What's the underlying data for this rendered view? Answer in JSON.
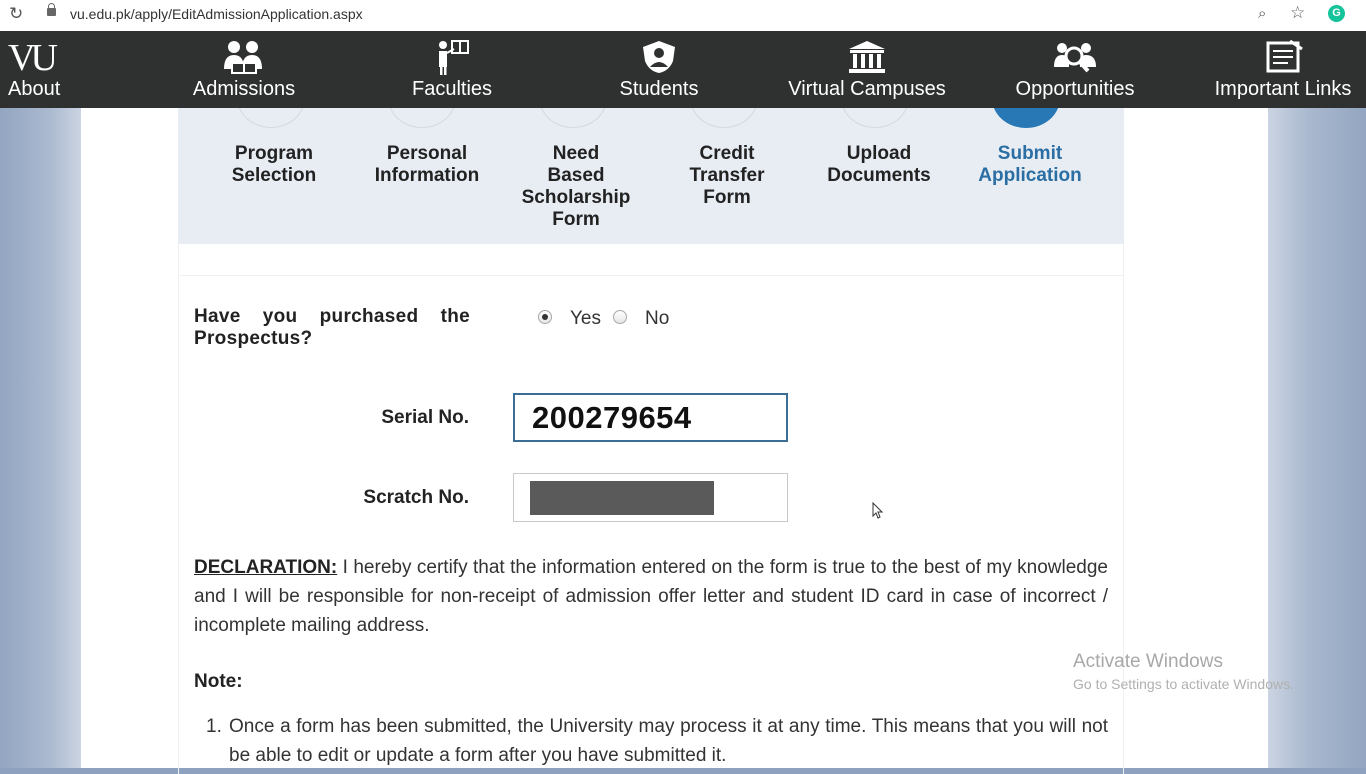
{
  "browser": {
    "url": "vu.edu.pk/apply/EditAdmissionApplication.aspx",
    "icons": [
      "reload-icon",
      "lock-icon",
      "zoom-icon",
      "bookmark-star-icon",
      "grammarly-icon"
    ],
    "ext_letter": "G"
  },
  "nav": {
    "logo": "VU",
    "items": [
      {
        "label": "About",
        "icon": "vu-logo"
      },
      {
        "label": "Admissions",
        "icon": "people-book-icon"
      },
      {
        "label": "Faculties",
        "icon": "teacher-board-icon"
      },
      {
        "label": "Students",
        "icon": "student-shield-icon"
      },
      {
        "label": "Virtual Campuses",
        "icon": "building-columns-icon"
      },
      {
        "label": "Opportunities",
        "icon": "people-search-icon"
      },
      {
        "label": "Important Links",
        "icon": "document-icon"
      }
    ]
  },
  "steps": [
    {
      "line1": "Program",
      "line2": "Selection",
      "line3": "",
      "line4": ""
    },
    {
      "line1": "Personal",
      "line2": "Information",
      "line3": "",
      "line4": ""
    },
    {
      "line1": "Need",
      "line2": "Based",
      "line3": "Scholarship",
      "line4": "Form"
    },
    {
      "line1": "Credit",
      "line2": "Transfer",
      "line3": "Form",
      "line4": ""
    },
    {
      "line1": "Upload",
      "line2": "Documents",
      "line3": "",
      "line4": ""
    },
    {
      "line1": "Submit",
      "line2": "Application",
      "line3": "",
      "line4": ""
    }
  ],
  "form": {
    "prospectus_q_line1": "Have you purchased the",
    "prospectus_q_line2": "Prospectus?",
    "yes_label": "Yes",
    "no_label": "No",
    "selected": "Yes",
    "serial_label": "Serial No.",
    "serial_value": "200279654",
    "scratch_label": "Scratch No."
  },
  "declaration": {
    "title": "DECLARATION:",
    "text": " I hereby certify that the information entered on the form is true to the best of my knowledge and I will be responsible for non-receipt of admission offer letter and student ID card in case of incorrect / incomplete mailing address."
  },
  "note": {
    "title": "Note:",
    "items": [
      {
        "num": "1.",
        "text": "Once a form has been submitted, the University may process it at any time. This means that you will not be able to edit or update a form after you have submitted it."
      }
    ]
  },
  "watermark": {
    "line1": "Activate Windows",
    "line2": "Go to Settings to activate Windows."
  },
  "colors": {
    "nav_bg": "#2f3131",
    "active_step": "#2878b6",
    "steps_bg": "#e8edf4",
    "page_side": "#93a5c1"
  }
}
